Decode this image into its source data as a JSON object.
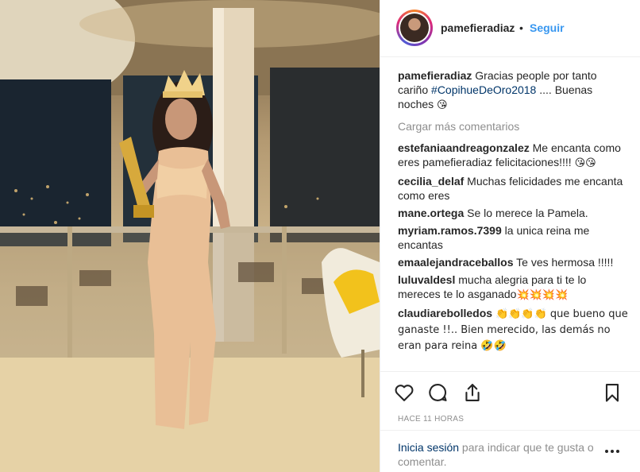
{
  "post": {
    "username": "pamefieradiaz",
    "dot": "•",
    "follow_label": "Seguir",
    "caption": {
      "user": "pamefieradiaz",
      "text_before": "Gracias people por tanto cariño ",
      "hashtag": "#CopihueDeOro2018",
      "text_after": " .... Buenas noches ",
      "emoji": "😘"
    },
    "load_more": "Cargar más comentarios",
    "comments": [
      {
        "user": "estefaniaandreagonzalez",
        "text": "Me encanta como eres pamefieradiaz felicitaciones!!!! ",
        "emoji": "😘😘"
      },
      {
        "user": "cecilia_delaf",
        "text": "Muchas felicidades me encanta como eres",
        "emoji": ""
      },
      {
        "user": "mane.ortega",
        "text": "Se lo merece la Pamela.",
        "emoji": ""
      },
      {
        "user": "myriam.ramos.7399",
        "text": "la unica reina me encantas",
        "emoji": ""
      },
      {
        "user": "emaalejandraceballos",
        "text": "Te ves hermosa !!!!!",
        "emoji": ""
      },
      {
        "user": "luluvaldesl",
        "text": "mucha alegria para ti te lo mereces te lo asganado",
        "emoji": "💥💥💥💥"
      },
      {
        "user": "claudiarebolledos",
        "text": "👏👏👏👏 que bueno que ganaste !!.. Bien merecido, las demás no eran para reina ",
        "emoji": "🤣🤣"
      }
    ],
    "timestamp": "HACE 11 HORAS",
    "footer": {
      "login_label": "Inicia sesión",
      "rest": " para indicar que te gusta o comentar."
    }
  },
  "icons": {
    "like": "heart-icon",
    "comment": "comment-icon",
    "share": "share-icon",
    "save": "bookmark-icon",
    "more": "more-icon"
  },
  "colors": {
    "accent": "#3897f0",
    "link": "#003569",
    "muted": "#8e8e8e",
    "text": "#262626"
  }
}
